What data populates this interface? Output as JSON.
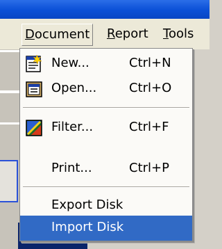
{
  "menubar": {
    "items": [
      {
        "prefix": "",
        "accel": "D",
        "rest": "ocument"
      },
      {
        "prefix": "",
        "accel": "R",
        "rest": "eport"
      },
      {
        "prefix": "",
        "accel": "T",
        "rest": "ools"
      }
    ]
  },
  "dropdown": {
    "items": [
      {
        "label": "New...",
        "shortcut": "Ctrl+N",
        "icon": "new-document-icon"
      },
      {
        "label": "Open...",
        "shortcut": "Ctrl+O",
        "icon": "open-document-icon"
      },
      {
        "label": "Filter...",
        "shortcut": "Ctrl+F",
        "icon": "filter-icon"
      },
      {
        "label": "Print...",
        "shortcut": "Ctrl+P",
        "icon": ""
      },
      {
        "label": "Export Disk",
        "shortcut": "",
        "icon": ""
      },
      {
        "label": "Import Disk",
        "shortcut": "",
        "icon": "",
        "selected": true
      }
    ]
  },
  "colors": {
    "title_bar": "#0a4fd6",
    "menu_bg": "#ece9d8",
    "highlight": "#316ac5"
  }
}
